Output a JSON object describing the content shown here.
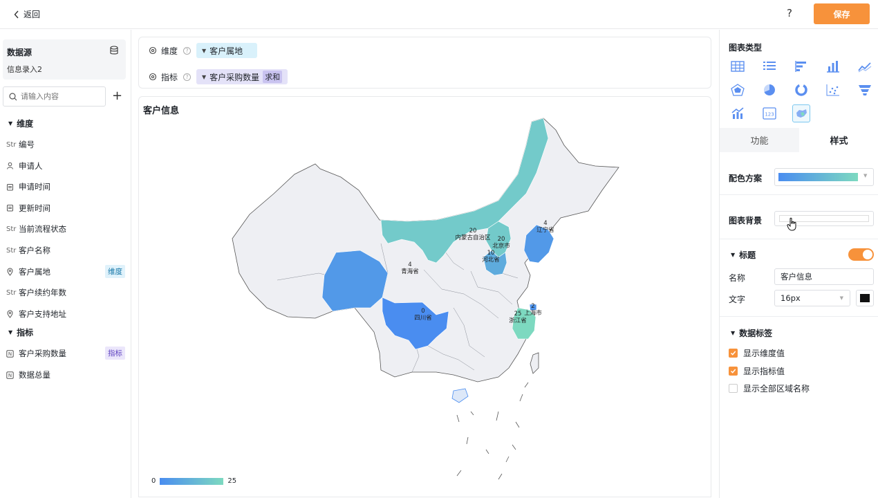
{
  "header": {
    "back_label": "返回",
    "help_label": "?",
    "save_label": "保存"
  },
  "sidebar": {
    "datasource_title": "数据源",
    "datasource_name": "信息录入2",
    "search_placeholder": "请输入内容",
    "add_label": "+",
    "dimension_title": "维度",
    "dimensions": [
      {
        "type": "Str",
        "label": "编号"
      },
      {
        "type": "person",
        "label": "申请人"
      },
      {
        "type": "date",
        "label": "申请时间"
      },
      {
        "type": "date",
        "label": "更新时间"
      },
      {
        "type": "Str",
        "label": "当前流程状态"
      },
      {
        "type": "Str",
        "label": "客户名称"
      },
      {
        "type": "location",
        "label": "客户属地",
        "tag": "维度"
      },
      {
        "type": "Str",
        "label": "客户续约年数"
      },
      {
        "type": "location",
        "label": "客户支持地址"
      }
    ],
    "metric_title": "指标",
    "metrics": [
      {
        "type": "N",
        "label": "客户采购数量",
        "tag": "指标"
      },
      {
        "type": "N",
        "label": "数据总量"
      }
    ]
  },
  "config": {
    "dimension_label": "维度",
    "dimension_value": "客户属地",
    "metric_label": "指标",
    "metric_value": "客户采购数量",
    "metric_agg": "求和",
    "help_glyph": "?"
  },
  "chart_data": {
    "type": "map",
    "title": "客户信息",
    "regions": [
      {
        "name": "内蒙古自治区",
        "value": 20
      },
      {
        "name": "北京市",
        "value": 20
      },
      {
        "name": "河北省",
        "value": 10
      },
      {
        "name": "辽宁省",
        "value": 4
      },
      {
        "name": "青海省",
        "value": 4
      },
      {
        "name": "四川省",
        "value": 0
      },
      {
        "name": "上海市",
        "value": 2
      },
      {
        "name": "浙江省",
        "value": 25
      }
    ],
    "visual_map": {
      "min": 0,
      "max": 25,
      "min_label": "0",
      "max_label": "25",
      "colors": [
        "#4a8df0",
        "#7dd9c0"
      ]
    },
    "base_color": "#eeeff3"
  },
  "panel": {
    "chart_type_title": "图表类型",
    "tab_func": "功能",
    "tab_style": "样式",
    "color_scheme_label": "配色方案",
    "background_label": "图表背景",
    "title_section": "标题",
    "name_label": "名称",
    "name_value": "客户信息",
    "text_label": "文字",
    "font_size": "16px",
    "text_color": "#111111",
    "data_label_section": "数据标签",
    "opt_show_dim": "显示维度值",
    "opt_show_metric": "显示指标值",
    "opt_show_all_regions": "显示全部区域名称"
  },
  "colors": {
    "accent": "#f7923b",
    "gradient_start": "#4a8df0",
    "gradient_end": "#7dd9c0"
  }
}
